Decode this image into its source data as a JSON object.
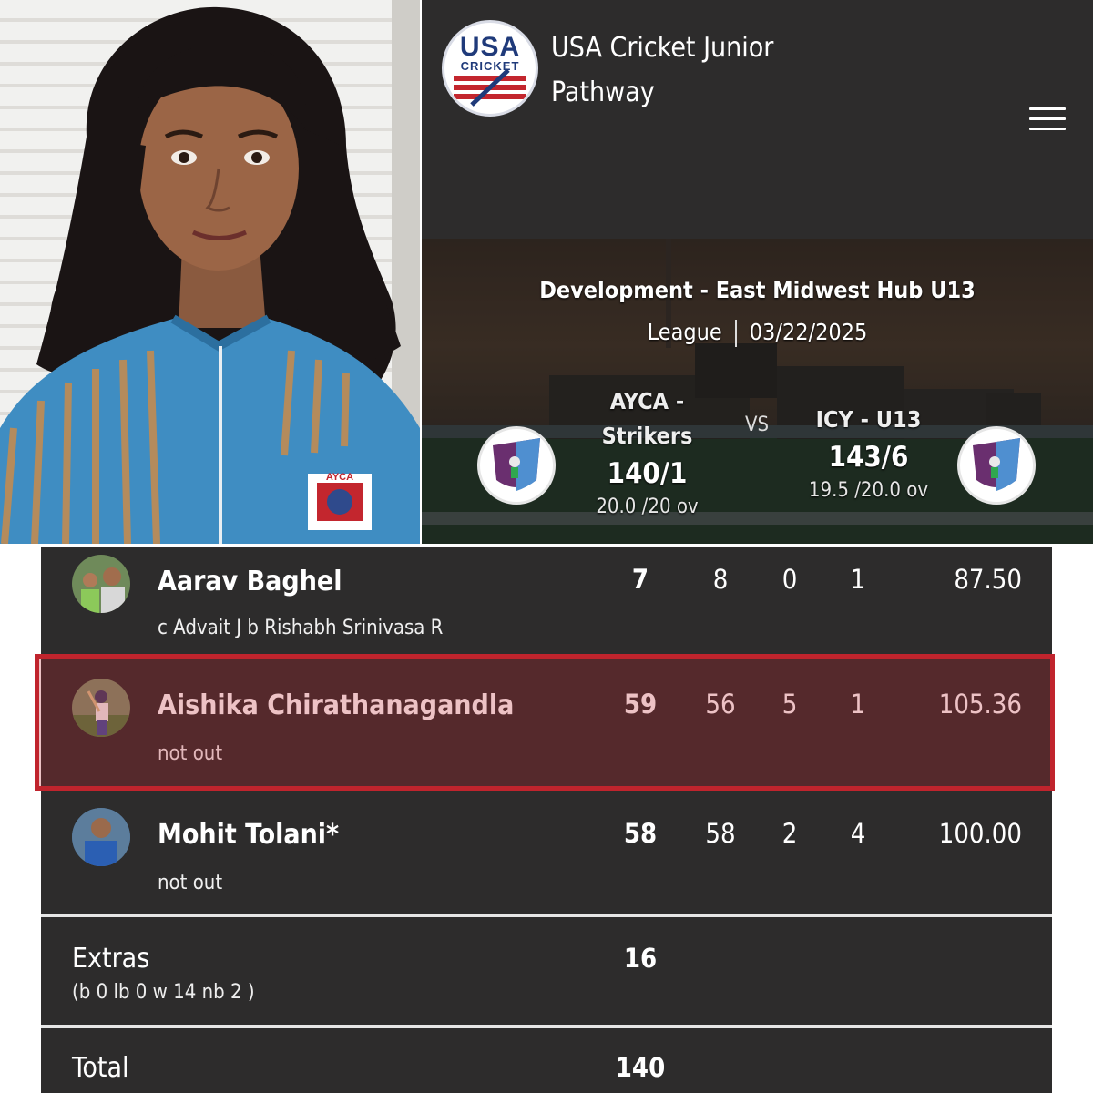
{
  "header": {
    "logo_word_top": "USA",
    "logo_word_bottom": "CRICKET",
    "title_line1": "USA Cricket Junior",
    "title_line2": "Pathway",
    "menu_icon": "hamburger-menu-icon"
  },
  "match": {
    "series": "Development - East Midwest Hub U13",
    "type": "League",
    "date": "03/22/2025",
    "vs_label": "VS",
    "home": {
      "name_line1": "AYCA -",
      "name_line2": "Strikers",
      "score": "140/1",
      "overs": "20.0 /20 ov"
    },
    "away": {
      "name": "ICY - U13",
      "score": "143/6",
      "overs": "19.5 /20.0 ov"
    }
  },
  "batting": [
    {
      "name": "Aarav Baghel",
      "dismissal": "c Advait J b Rishabh Srinivasa R",
      "runs": "7",
      "balls": "8",
      "fours": "0",
      "sixes": "1",
      "strike_rate": "87.50"
    },
    {
      "name": "Aishika Chirathanagandla",
      "dismissal": "not out",
      "runs": "59",
      "balls": "56",
      "fours": "5",
      "sixes": "1",
      "strike_rate": "105.36",
      "highlighted": true
    },
    {
      "name": "Mohit Tolani*",
      "dismissal": "not out",
      "runs": "58",
      "balls": "58",
      "fours": "2",
      "sixes": "4",
      "strike_rate": "100.00"
    }
  ],
  "extras": {
    "label": "Extras",
    "detail": "(b 0 lb 0 w 14 nb 2 )",
    "value": "16"
  },
  "total": {
    "label": "Total",
    "value": "140"
  },
  "colors": {
    "panel": "#2d2c2c",
    "highlight": "#c0242d",
    "divider": "#e6e6e6"
  }
}
